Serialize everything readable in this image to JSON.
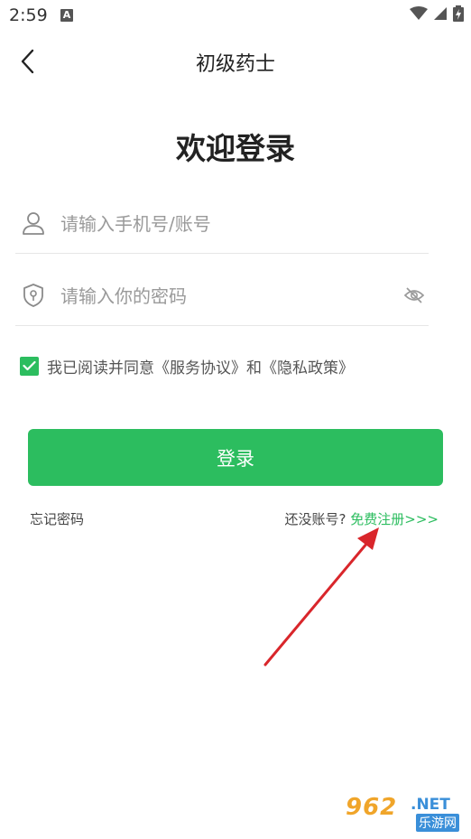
{
  "status_bar": {
    "time": "2:59",
    "notification_letter": "A",
    "icons": [
      "wifi-icon",
      "signal-icon",
      "battery-charging-icon"
    ]
  },
  "header": {
    "back_icon": "chevron-left-icon",
    "title": "初级药士"
  },
  "main": {
    "welcome": "欢迎登录",
    "phone_field": {
      "icon": "user-icon",
      "placeholder": "请输入手机号/账号",
      "value": ""
    },
    "password_field": {
      "icon": "shield-lock-icon",
      "placeholder": "请输入你的密码",
      "value": "",
      "toggle_icon": "eye-off-icon"
    },
    "agreement": {
      "checked": true,
      "prefix": "我已阅读并同意",
      "service_link": "《服务协议》",
      "conjunction": "和",
      "privacy_link": "《隐私政策》"
    },
    "login_button": "登录",
    "forgot_password": "忘记密码",
    "no_account": "还没账号?",
    "register_link": "免费注册>>>"
  },
  "watermark": {
    "logo": "962",
    "net": ".NET",
    "sub": "乐游网"
  },
  "colors": {
    "accent": "#2cbd5f",
    "arrow": "#d9262b",
    "text_dark": "#222222",
    "placeholder": "#9a9a9a"
  }
}
